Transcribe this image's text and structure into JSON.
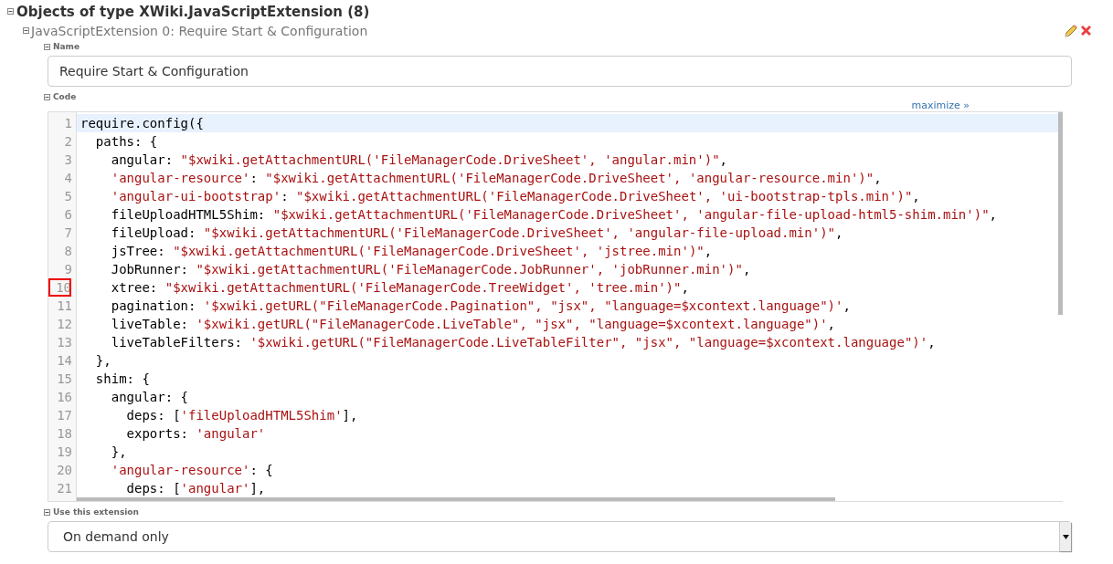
{
  "section": {
    "title": "Objects of type XWiki.JavaScriptExtension (8)",
    "expanded": true
  },
  "object": {
    "title": "JavaScriptExtension 0: Require Start & Configuration",
    "expanded": true
  },
  "name_field": {
    "label": "Name",
    "value": "Require Start & Configuration"
  },
  "code_field": {
    "label": "Code",
    "maximize_link": "maximize »",
    "lines": [
      {
        "number": "1",
        "current": true,
        "flagged": false,
        "segments": [
          {
            "kind": "plain",
            "text": "require.config({"
          }
        ]
      },
      {
        "number": "2",
        "current": false,
        "flagged": false,
        "segments": [
          {
            "kind": "plain",
            "text": "  paths: {"
          }
        ]
      },
      {
        "number": "3",
        "current": false,
        "flagged": false,
        "segments": [
          {
            "kind": "plain",
            "text": "    angular: "
          },
          {
            "kind": "string",
            "text": "\"$xwiki.getAttachmentURL('FileManagerCode.DriveSheet', 'angular.min')\""
          },
          {
            "kind": "plain",
            "text": ","
          }
        ]
      },
      {
        "number": "4",
        "current": false,
        "flagged": false,
        "segments": [
          {
            "kind": "string",
            "text": "    'angular-resource'"
          },
          {
            "kind": "plain",
            "text": ": "
          },
          {
            "kind": "string",
            "text": "\"$xwiki.getAttachmentURL('FileManagerCode.DriveSheet', 'angular-resource.min')\""
          },
          {
            "kind": "plain",
            "text": ","
          }
        ]
      },
      {
        "number": "5",
        "current": false,
        "flagged": false,
        "segments": [
          {
            "kind": "string",
            "text": "    'angular-ui-bootstrap'"
          },
          {
            "kind": "plain",
            "text": ": "
          },
          {
            "kind": "string",
            "text": "\"$xwiki.getAttachmentURL('FileManagerCode.DriveSheet', 'ui-bootstrap-tpls.min')\""
          },
          {
            "kind": "plain",
            "text": ","
          }
        ]
      },
      {
        "number": "6",
        "current": false,
        "flagged": false,
        "segments": [
          {
            "kind": "plain",
            "text": "    fileUploadHTML5Shim: "
          },
          {
            "kind": "string",
            "text": "\"$xwiki.getAttachmentURL('FileManagerCode.DriveSheet', 'angular-file-upload-html5-shim.min')\""
          },
          {
            "kind": "plain",
            "text": ","
          }
        ]
      },
      {
        "number": "7",
        "current": false,
        "flagged": false,
        "segments": [
          {
            "kind": "plain",
            "text": "    fileUpload: "
          },
          {
            "kind": "string",
            "text": "\"$xwiki.getAttachmentURL('FileManagerCode.DriveSheet', 'angular-file-upload.min')\""
          },
          {
            "kind": "plain",
            "text": ","
          }
        ]
      },
      {
        "number": "8",
        "current": false,
        "flagged": false,
        "segments": [
          {
            "kind": "plain",
            "text": "    jsTree: "
          },
          {
            "kind": "string",
            "text": "\"$xwiki.getAttachmentURL('FileManagerCode.DriveSheet', 'jstree.min')\""
          },
          {
            "kind": "plain",
            "text": ","
          }
        ]
      },
      {
        "number": "9",
        "current": false,
        "flagged": false,
        "segments": [
          {
            "kind": "plain",
            "text": "    JobRunner: "
          },
          {
            "kind": "string",
            "text": "\"$xwiki.getAttachmentURL('FileManagerCode.JobRunner', 'jobRunner.min')\""
          },
          {
            "kind": "plain",
            "text": ","
          }
        ]
      },
      {
        "number": "10",
        "current": false,
        "flagged": true,
        "segments": [
          {
            "kind": "plain",
            "text": "    xtree: "
          },
          {
            "kind": "string",
            "text": "\"$xwiki.getAttachmentURL('FileManagerCode.TreeWidget', 'tree.min')\""
          },
          {
            "kind": "plain",
            "text": ","
          }
        ]
      },
      {
        "number": "11",
        "current": false,
        "flagged": false,
        "segments": [
          {
            "kind": "plain",
            "text": "    pagination: "
          },
          {
            "kind": "string",
            "text": "'$xwiki.getURL(\"FileManagerCode.Pagination\", \"jsx\", \"language=$xcontext.language\")'"
          },
          {
            "kind": "plain",
            "text": ","
          }
        ]
      },
      {
        "number": "12",
        "current": false,
        "flagged": false,
        "segments": [
          {
            "kind": "plain",
            "text": "    liveTable: "
          },
          {
            "kind": "string",
            "text": "'$xwiki.getURL(\"FileManagerCode.LiveTable\", \"jsx\", \"language=$xcontext.language\")'"
          },
          {
            "kind": "plain",
            "text": ","
          }
        ]
      },
      {
        "number": "13",
        "current": false,
        "flagged": false,
        "segments": [
          {
            "kind": "plain",
            "text": "    liveTableFilters: "
          },
          {
            "kind": "string",
            "text": "'$xwiki.getURL(\"FileManagerCode.LiveTableFilter\", \"jsx\", \"language=$xcontext.language\")'"
          },
          {
            "kind": "plain",
            "text": ","
          }
        ]
      },
      {
        "number": "14",
        "current": false,
        "flagged": false,
        "segments": [
          {
            "kind": "plain",
            "text": "  },"
          }
        ]
      },
      {
        "number": "15",
        "current": false,
        "flagged": false,
        "segments": [
          {
            "kind": "plain",
            "text": "  shim: {"
          }
        ]
      },
      {
        "number": "16",
        "current": false,
        "flagged": false,
        "segments": [
          {
            "kind": "plain",
            "text": "    angular: {"
          }
        ]
      },
      {
        "number": "17",
        "current": false,
        "flagged": false,
        "segments": [
          {
            "kind": "plain",
            "text": "      deps: ["
          },
          {
            "kind": "string",
            "text": "'fileUploadHTML5Shim'"
          },
          {
            "kind": "plain",
            "text": "],"
          }
        ]
      },
      {
        "number": "18",
        "current": false,
        "flagged": false,
        "segments": [
          {
            "kind": "plain",
            "text": "      exports: "
          },
          {
            "kind": "string",
            "text": "'angular'"
          }
        ]
      },
      {
        "number": "19",
        "current": false,
        "flagged": false,
        "segments": [
          {
            "kind": "plain",
            "text": "    },"
          }
        ]
      },
      {
        "number": "20",
        "current": false,
        "flagged": false,
        "segments": [
          {
            "kind": "string",
            "text": "    'angular-resource'"
          },
          {
            "kind": "plain",
            "text": ": {"
          }
        ]
      },
      {
        "number": "21",
        "current": false,
        "flagged": false,
        "segments": [
          {
            "kind": "plain",
            "text": "      deps: ["
          },
          {
            "kind": "string",
            "text": "'angular'"
          },
          {
            "kind": "plain",
            "text": "],"
          }
        ]
      }
    ]
  },
  "use_field": {
    "label": "Use this extension",
    "value": "On demand only"
  }
}
